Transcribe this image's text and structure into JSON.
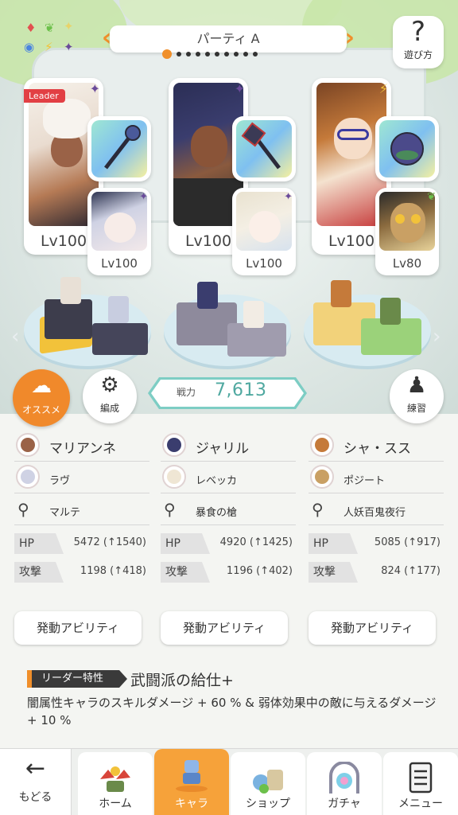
{
  "party": {
    "name": "パーティ A",
    "page_index": 1,
    "page_count": 10
  },
  "help": {
    "label": "遊び方",
    "icon": "question-icon"
  },
  "leader_badge": "Leader",
  "slots": [
    {
      "main_level": "Lv100",
      "main_element": "dark",
      "sub_level": "Lv100",
      "sub_element": "dark",
      "weapon_element": "holy"
    },
    {
      "main_level": "Lv100",
      "main_element": "dark",
      "sub_level": "Lv100",
      "sub_element": "dark",
      "weapon_element": "holy"
    },
    {
      "main_level": "Lv100",
      "main_element": "lightning",
      "sub_level": "Lv80",
      "sub_element": "wind",
      "weapon_element": "holy"
    }
  ],
  "buttons": {
    "recommend": "オススメ",
    "edit": "編成",
    "practice": "練習"
  },
  "power": {
    "label": "戦力",
    "value": "7,613"
  },
  "columns": [
    {
      "main": "マリアンネ",
      "sub": "ラヴ",
      "weapon": "マルテ",
      "hp_label": "HP",
      "hp": "5472 (↑1540)",
      "atk_label": "攻撃",
      "atk": "1198 (↑418)",
      "ability": "発動アビリティ"
    },
    {
      "main": "ジャリル",
      "sub": "レベッカ",
      "weapon": "暴食の槍",
      "hp_label": "HP",
      "hp": "4920 (↑1425)",
      "atk_label": "攻撃",
      "atk": "1196 (↑402)",
      "ability": "発動アビリティ"
    },
    {
      "main": "シャ・スス",
      "sub": "ポジート",
      "weapon": "人妖百鬼夜行",
      "hp_label": "HP",
      "hp": "5085 (↑917)",
      "atk_label": "攻撃",
      "atk": "824 (↑177)",
      "ability": "発動アビリティ"
    }
  ],
  "leader_trait": {
    "label": "リーダー特性",
    "name": "武闘派の給仕+",
    "description": "闇属性キャラのスキルダメージ + 60 % & 弱体効果中の敵に与えるダメージ + 10 %"
  },
  "nav": {
    "back": "もどる",
    "tabs": [
      {
        "label": "ホーム",
        "icon": "home-icon",
        "active": false
      },
      {
        "label": "キャラ",
        "icon": "character-icon",
        "active": true
      },
      {
        "label": "ショップ",
        "icon": "shop-icon",
        "active": false
      },
      {
        "label": "ガチャ",
        "icon": "gacha-icon",
        "active": false
      },
      {
        "label": "メニュー",
        "icon": "menu-icon",
        "active": false
      }
    ]
  },
  "colors": {
    "accent": "#f08f2a",
    "power": "#7dcdc4",
    "leader_badge": "#e23f44",
    "active_tab": "#f6a23a"
  }
}
